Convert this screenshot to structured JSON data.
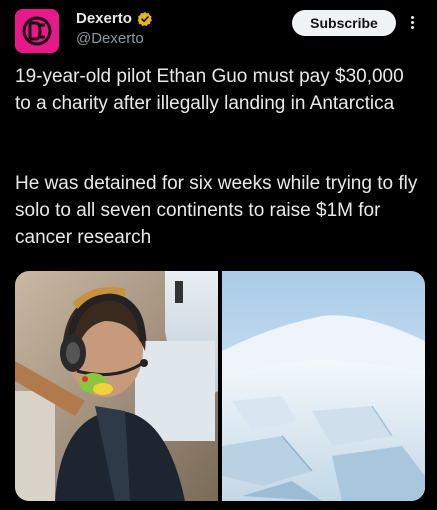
{
  "header": {
    "display_name": "Dexerto",
    "handle": "@Dexerto",
    "subscribe_label": "Subscribe"
  },
  "tweet": {
    "paragraph1": "19-year-old pilot Ethan Guo must pay $30,000 to a charity after illegally landing in Antarctica",
    "paragraph2": "He was detained for six weeks while trying to fly solo to all seven continents to raise $1M for cancer research"
  },
  "media": {
    "photos": [
      "pilot-in-cockpit",
      "antarctica-ice-landscape"
    ]
  },
  "colors": {
    "background": "#000000",
    "avatar_brand": "#e8178a",
    "verified_badge": "#e2b719",
    "subscribe_bg": "#eff3f4"
  }
}
